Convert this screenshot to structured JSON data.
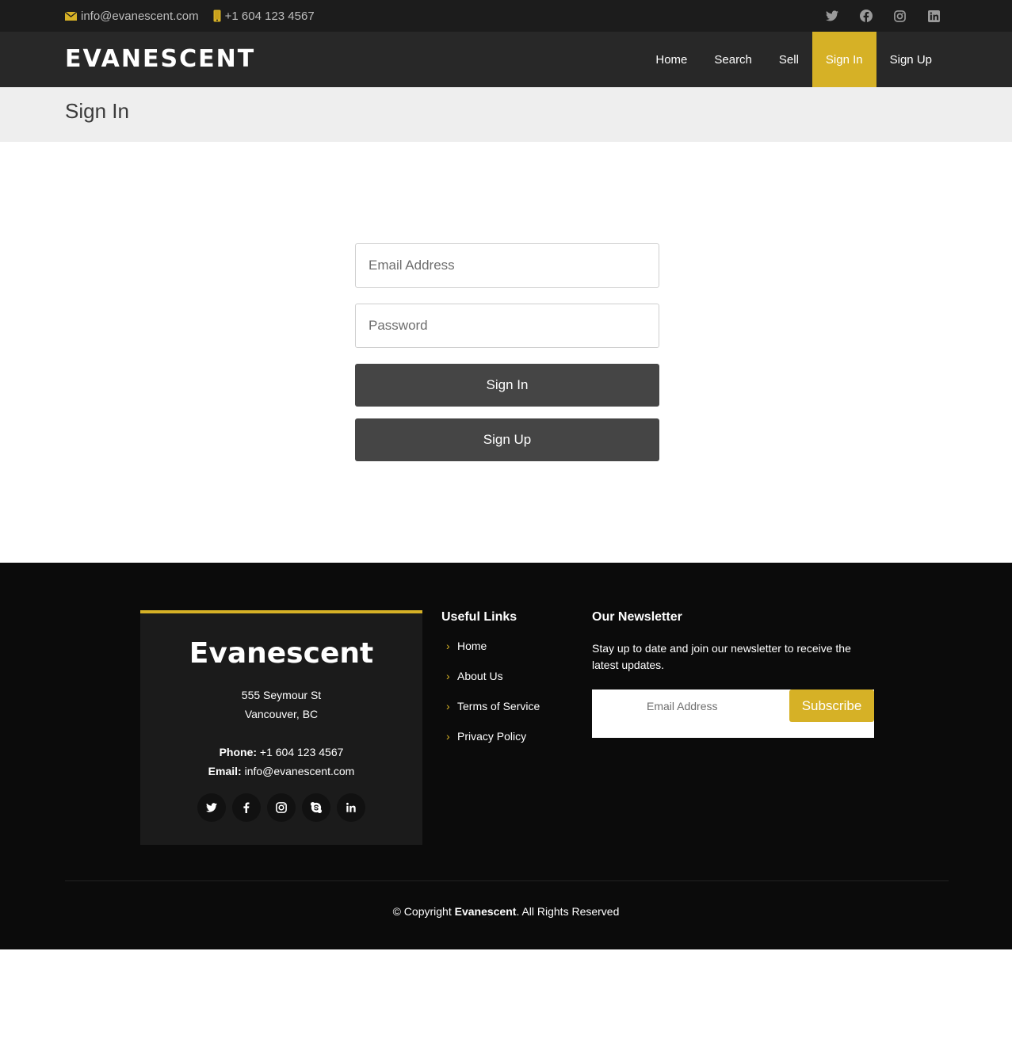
{
  "topbar": {
    "email": "info@evanescent.com",
    "phone": "+1 604 123 4567",
    "email_icon": "envelope-icon",
    "phone_icon": "mobile-phone-icon",
    "social_icons": [
      "twitter-icon",
      "facebook-icon",
      "instagram-icon",
      "linkedin-icon"
    ]
  },
  "header": {
    "logo": "EVANESCENT",
    "nav": [
      {
        "label": "Home"
      },
      {
        "label": "Search"
      },
      {
        "label": "Sell"
      },
      {
        "label": "Sign In",
        "active": true
      },
      {
        "label": "Sign Up"
      }
    ]
  },
  "page": {
    "title": "Sign In"
  },
  "form": {
    "email_placeholder": "Email Address",
    "password_placeholder": "Password",
    "sign_in_label": "Sign In",
    "sign_up_label": "Sign Up"
  },
  "footer": {
    "brand": "Evanescent",
    "address_line1": "555 Seymour St",
    "address_line2": "Vancouver, BC",
    "phone_label": "Phone:",
    "phone": "+1 604 123 4567",
    "email_label": "Email:",
    "email": "info@evanescent.com",
    "social_icons": [
      "twitter-icon",
      "facebook-icon",
      "instagram-icon",
      "skype-icon",
      "linkedin-icon"
    ],
    "links_title": "Useful Links",
    "links": [
      "Home",
      "About Us",
      "Terms of Service",
      "Privacy Policy"
    ],
    "newsletter_title": "Our Newsletter",
    "newsletter_text": "Stay up to date and join our newsletter to receive the latest updates.",
    "newsletter_placeholder": "Email Address",
    "subscribe_label": "Subscribe",
    "copyright_prefix": "© Copyright",
    "copyright_brand": "Evanescent",
    "copyright_suffix": ". All Rights Reserved"
  },
  "colors": {
    "accent": "#d6b126",
    "topbar_bg": "#1c1c1c",
    "header_bg": "#282828",
    "button_bg": "#454545",
    "footer_bg": "#0b0b0b"
  }
}
